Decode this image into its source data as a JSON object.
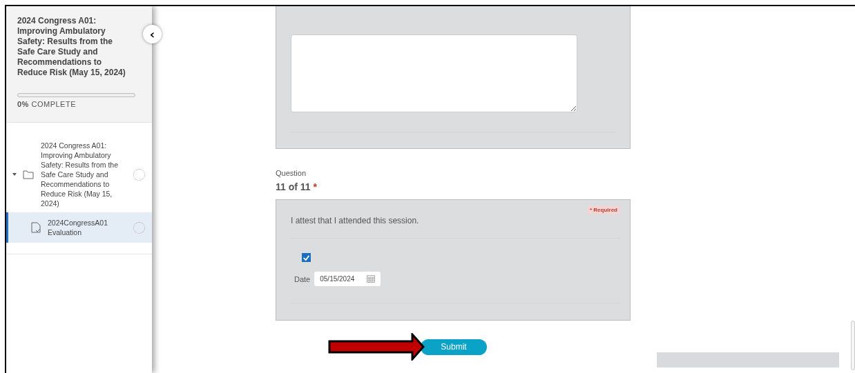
{
  "sidebar": {
    "title": "2024 Congress A01: Improving Ambulatory Safety: Results from the Safe Care Study and Recommendations to Reduce Risk (May 15, 2024)",
    "collapse_icon": "‹",
    "progress": {
      "level": 0,
      "label": "**0%** COMPLETE"
    },
    "tree": [
      {
        "label": "2024 Congress A01: Improving Ambulatory Safety: Results from the Safe Care Study and Recommendations to Reduce Risk (May 15, 2024)",
        "kind": "folder",
        "expanded": true,
        "selected": false,
        "children": [
          {
            "label": "2024CongressA01 Evaluation",
            "kind": "document",
            "selected": true
          }
        ]
      }
    ]
  },
  "question": {
    "label": "Question",
    "number": "11 of 11",
    "required_mark": "*",
    "card": {
      "required_badge": "* Required",
      "prompt": "I attest that I attended this session.",
      "checked": true,
      "date_label": "Date",
      "date_value": "05/15/2024"
    }
  },
  "submit": "Submit"
}
